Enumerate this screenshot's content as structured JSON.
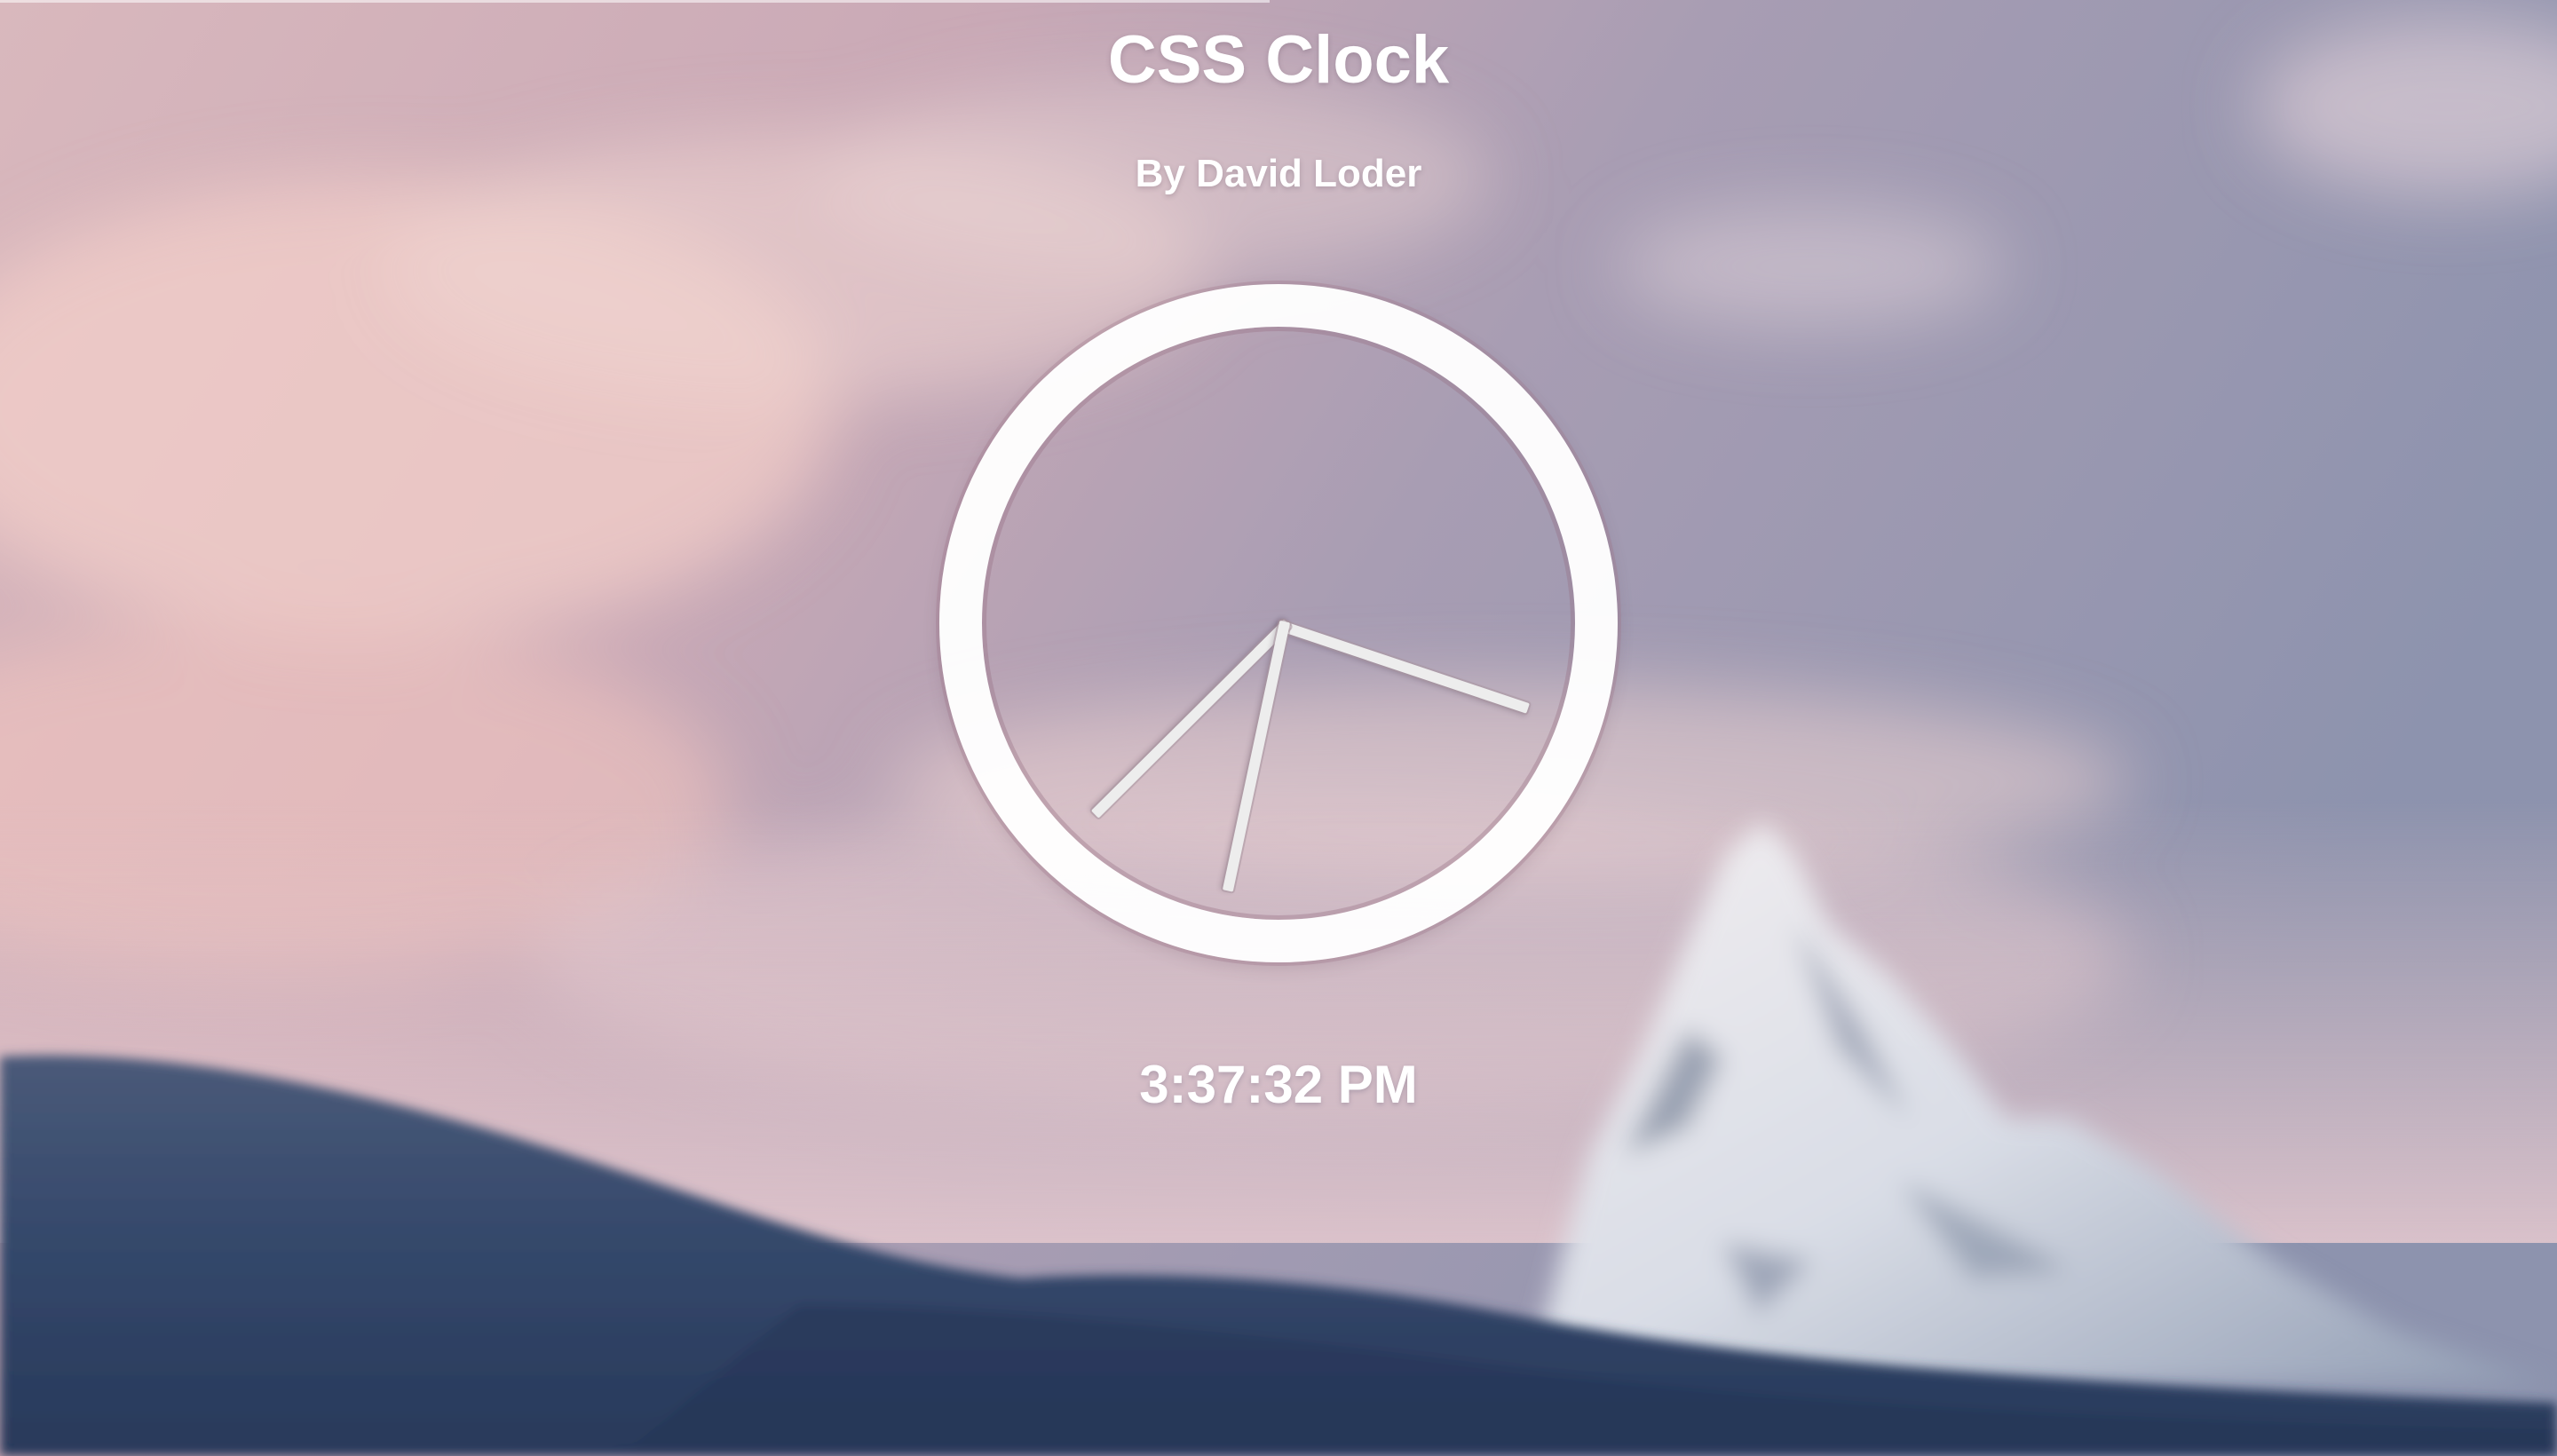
{
  "header": {
    "title": "CSS Clock",
    "subtitle": "By David Loder"
  },
  "clock": {
    "hours": 3,
    "minutes": 37,
    "seconds": 32,
    "digital_time": "3:37:32 PM"
  },
  "background": {
    "description_icon": "mountain-landscape-image",
    "sky_top": "#b7a5b8",
    "sky_pink": "#e8c1c0",
    "mountain_snow": "#e7ebf0",
    "foreground_hill": "#2e405f"
  }
}
